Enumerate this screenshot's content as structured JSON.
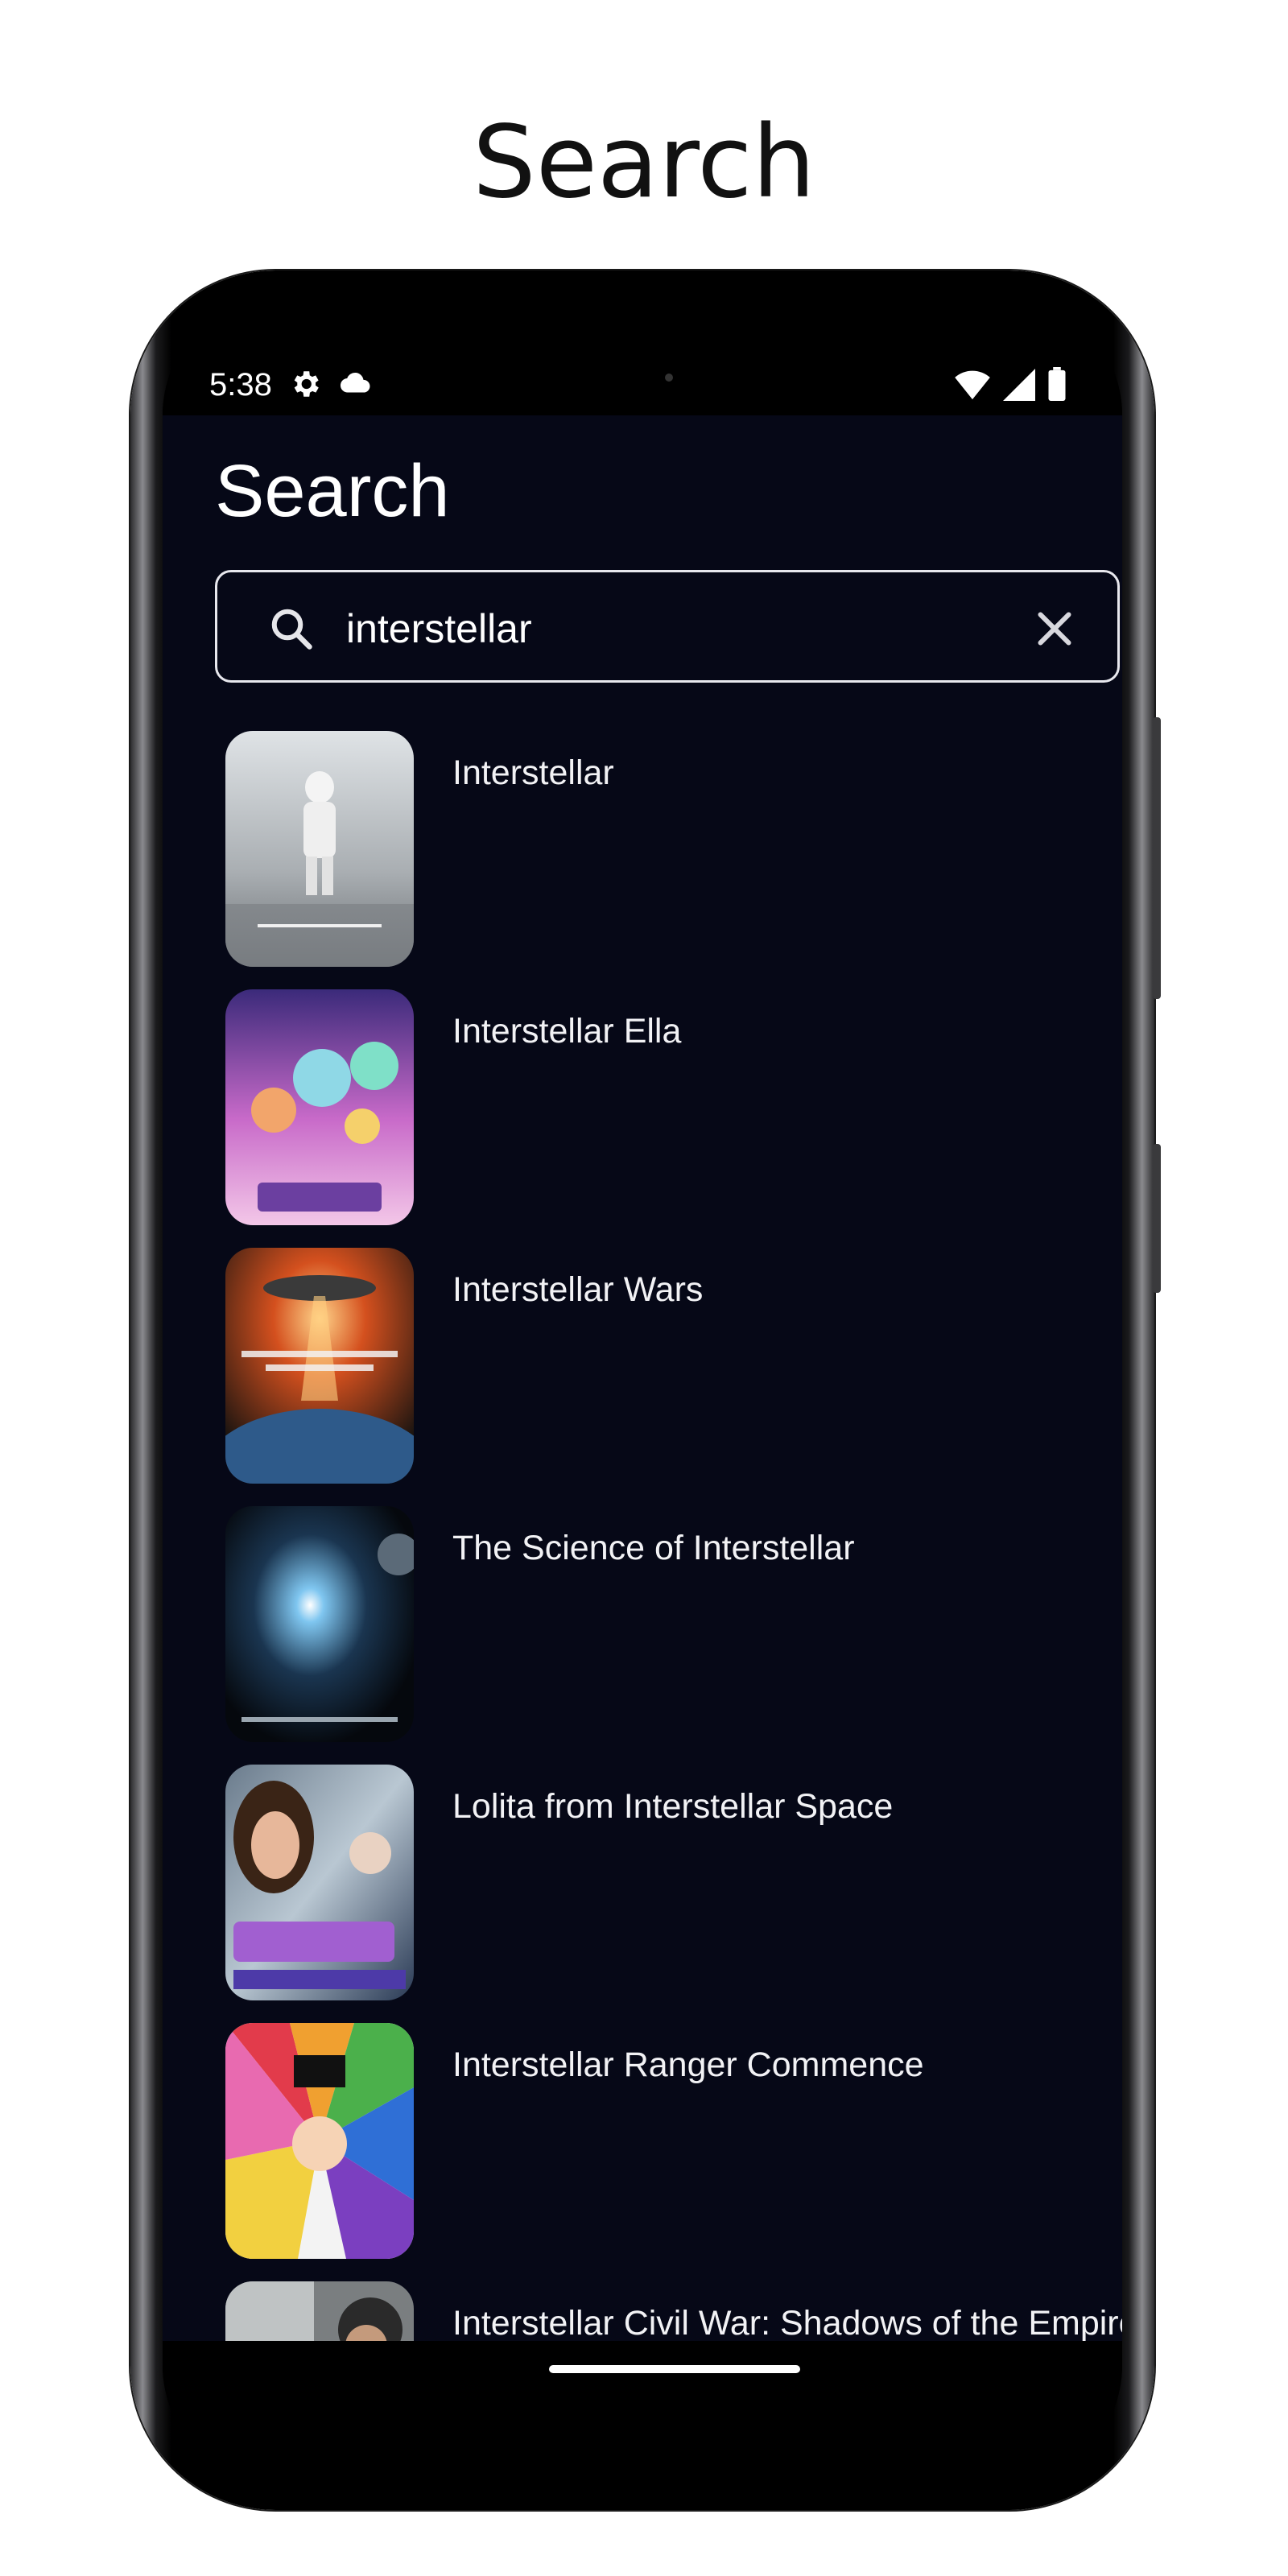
{
  "page_heading": "Search",
  "status_bar": {
    "time": "5:38",
    "left_icons": [
      "settings-icon",
      "cloud-icon"
    ],
    "right_icons": [
      "wifi-icon",
      "signal-icon",
      "battery-icon"
    ]
  },
  "app": {
    "title": "Search",
    "search": {
      "value": "interstellar",
      "search_icon": "search-icon",
      "clear_icon": "close-icon"
    },
    "results": [
      {
        "title": "Interstellar"
      },
      {
        "title": "Interstellar Ella"
      },
      {
        "title": "Interstellar Wars"
      },
      {
        "title": "The Science of Interstellar"
      },
      {
        "title": "Lolita from Interstellar Space"
      },
      {
        "title": "Interstellar Ranger Commence"
      },
      {
        "title": "Interstellar Civil War: Shadows of the Empire"
      }
    ]
  },
  "colors": {
    "app_background": "#060817",
    "text": "#ffffff",
    "search_border": "#e8e8ee"
  }
}
